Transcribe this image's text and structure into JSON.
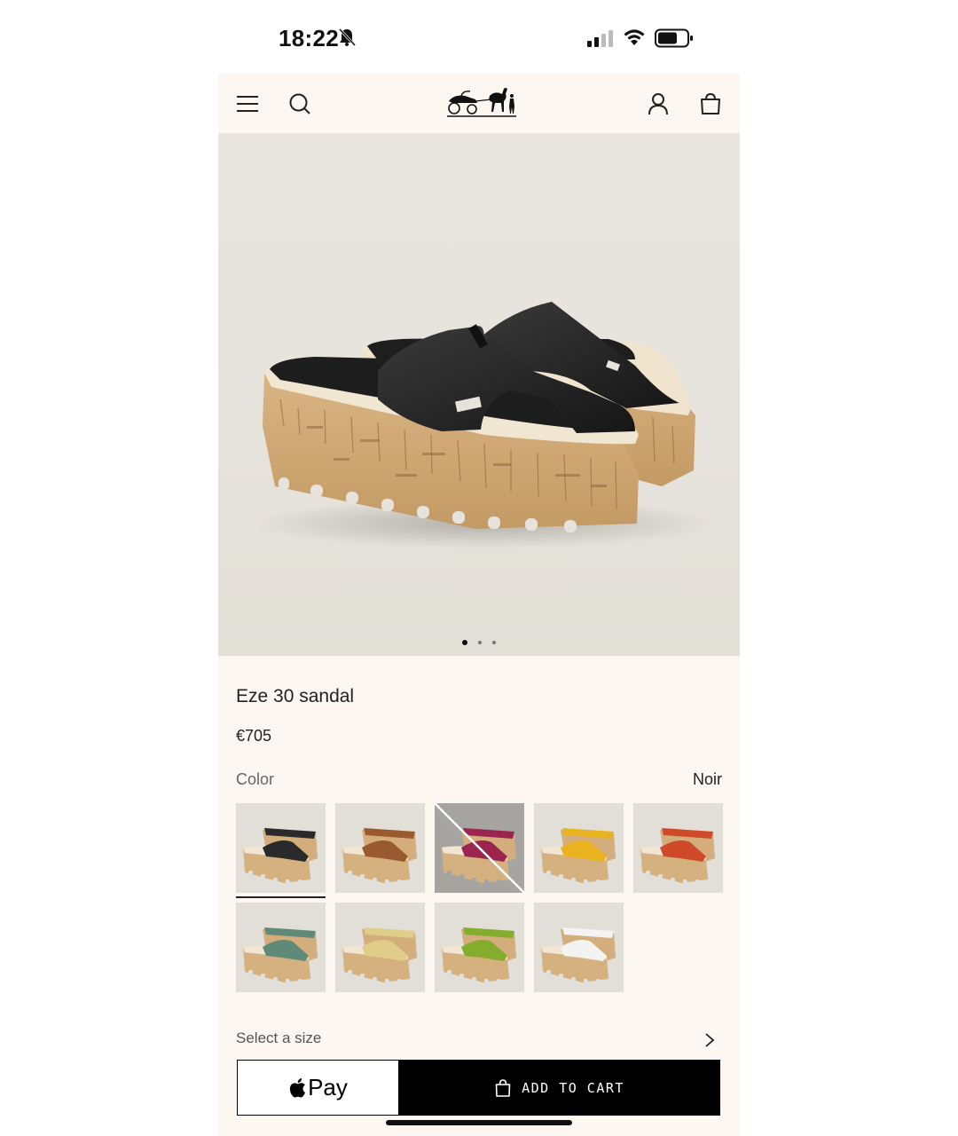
{
  "status": {
    "time": "18:22"
  },
  "nav": {
    "logo_alt": "Hermès carriage logo"
  },
  "product": {
    "title": "Eze 30 sandal",
    "price": "€705",
    "color_label": "Color",
    "color_value": "Noir"
  },
  "gallery": {
    "total_images": 3,
    "current_image": 1
  },
  "swatches": [
    {
      "strap": "#2a2a2a",
      "selected": true,
      "available": true
    },
    {
      "strap": "#9a5a30",
      "selected": false,
      "available": true
    },
    {
      "strap": "#9c2550",
      "selected": false,
      "available": false
    },
    {
      "strap": "#e9b21e",
      "selected": false,
      "available": true
    },
    {
      "strap": "#cf4a28",
      "selected": false,
      "available": true
    },
    {
      "strap": "#5f8a78",
      "selected": false,
      "available": true
    },
    {
      "strap": "#e1cd8a",
      "selected": false,
      "available": true
    },
    {
      "strap": "#84ad2e",
      "selected": false,
      "available": true
    },
    {
      "strap": "#f3f3f1",
      "selected": false,
      "available": true
    }
  ],
  "size": {
    "label": "Select a size"
  },
  "cta": {
    "applepay_label": "Pay",
    "add_to_cart_label": "ADD TO CART"
  }
}
